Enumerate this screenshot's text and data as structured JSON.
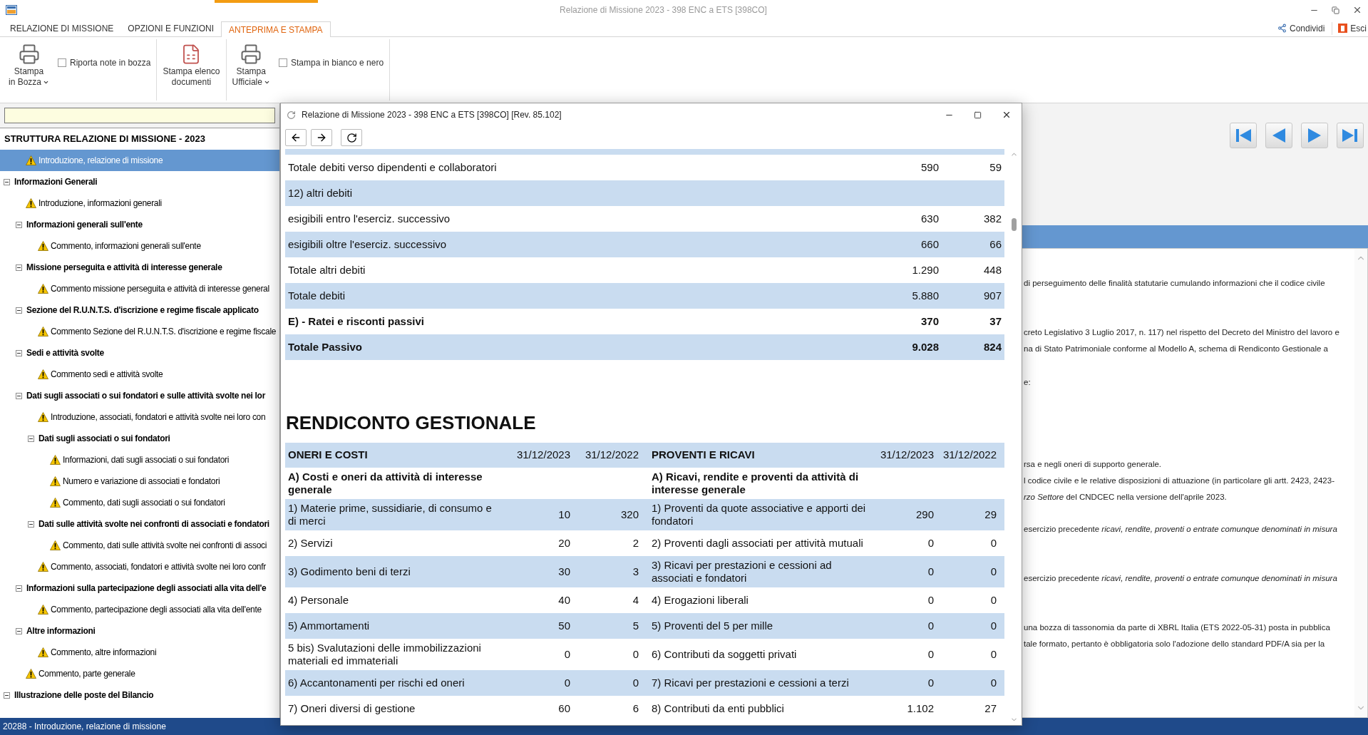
{
  "app": {
    "title": "Relazione di Missione 2023 - 398 ENC a ETS [398CO]"
  },
  "ribbon_tabs": [
    {
      "label": "RELAZIONE DI MISSIONE",
      "selected": false
    },
    {
      "label": "OPZIONI E FUNZIONI",
      "selected": false
    },
    {
      "label": "ANTEPRIMA E STAMPA",
      "selected": true
    }
  ],
  "ribbon_actions": [
    {
      "kind": "share",
      "label": "Condividi"
    },
    {
      "kind": "exit",
      "label": "Esci"
    }
  ],
  "ribbon": {
    "groups": [
      {
        "items": [
          {
            "kind": "print",
            "lines": [
              "Stampa",
              "in Bozza"
            ],
            "dropdown": true
          },
          {
            "kind": "checkbox",
            "label": "Riporta note in bozza",
            "checked": false
          }
        ]
      },
      {
        "items": [
          {
            "kind": "list",
            "lines": [
              "Stampa elenco",
              "documenti"
            ],
            "dropdown": false
          }
        ]
      },
      {
        "items": [
          {
            "kind": "print",
            "lines": [
              "Stampa",
              "Ufficiale"
            ],
            "dropdown": true
          },
          {
            "kind": "checkbox",
            "label": "Stampa in bianco e nero",
            "checked": false
          }
        ]
      }
    ]
  },
  "tree": {
    "title": "STRUTTURA RELAZIONE DI MISSIONE - 2023",
    "items": [
      {
        "kind": "item",
        "label": "Introduzione, relazione di missione",
        "selected": true
      },
      {
        "kind": "folder",
        "label": "Informazioni Generali",
        "selected": false,
        "expanded": true,
        "children": [
          {
            "kind": "item",
            "label": "Introduzione, informazioni generali",
            "selected": false
          },
          {
            "kind": "folder",
            "label": "Informazioni generali sull'ente",
            "selected": false,
            "expanded": true,
            "children": [
              {
                "kind": "item",
                "label": "Commento, informazioni generali sull'ente",
                "selected": false
              }
            ]
          },
          {
            "kind": "folder",
            "label": "Missione perseguita e attività di interesse generale",
            "selected": false,
            "expanded": true,
            "children": [
              {
                "kind": "item",
                "label": "Commento missione perseguita e attività di interesse general",
                "selected": false
              }
            ]
          },
          {
            "kind": "folder",
            "label": "Sezione del R.U.N.T.S. d'iscrizione e regime fiscale applicato",
            "selected": false,
            "expanded": true,
            "children": [
              {
                "kind": "item",
                "label": "Commento Sezione del R.U.N.T.S. d'iscrizione e regime fiscale",
                "selected": false
              }
            ]
          },
          {
            "kind": "folder",
            "label": "Sedi e attività svolte",
            "selected": false,
            "expanded": true,
            "children": [
              {
                "kind": "item",
                "label": "Commento sedi e attività svolte",
                "selected": false
              }
            ]
          },
          {
            "kind": "folder",
            "label": "Dati sugli associati o sui fondatori e sulle attività svolte nei lor",
            "selected": false,
            "expanded": true,
            "children": [
              {
                "kind": "item",
                "label": "Introduzione, associati, fondatori e attività svolte nei loro con",
                "selected": false
              },
              {
                "kind": "folder",
                "label": "Dati sugli associati o sui fondatori",
                "selected": false,
                "expanded": true,
                "children": [
                  {
                    "kind": "item",
                    "label": "Informazioni, dati sugli associati o sui fondatori",
                    "selected": false
                  },
                  {
                    "kind": "item",
                    "label": "Numero e variazione di associati e fondatori",
                    "selected": false
                  },
                  {
                    "kind": "item",
                    "label": "Commento, dati sugli associati o sui fondatori",
                    "selected": false
                  }
                ]
              },
              {
                "kind": "folder",
                "label": "Dati sulle attività svolte nei confronti di associati e fondatori",
                "selected": false,
                "expanded": true,
                "children": [
                  {
                    "kind": "item",
                    "label": "Commento, dati sulle attività svolte nei confronti di associ",
                    "selected": false
                  }
                ]
              },
              {
                "kind": "item",
                "label": "Commento, associati, fondatori e attività svolte nei loro confr",
                "selected": false
              }
            ]
          },
          {
            "kind": "folder",
            "label": "Informazioni sulla partecipazione degli associati alla vita dell'e",
            "selected": false,
            "expanded": true,
            "children": [
              {
                "kind": "item",
                "label": "Commento, partecipazione degli associati alla vita dell'ente",
                "selected": false
              }
            ]
          },
          {
            "kind": "folder",
            "label": "Altre informazioni",
            "selected": false,
            "expanded": true,
            "children": [
              {
                "kind": "item",
                "label": "Commento,  altre  informazioni",
                "selected": false
              }
            ]
          },
          {
            "kind": "item",
            "label": "Commento, parte generale",
            "selected": false
          }
        ]
      },
      {
        "kind": "folder",
        "label": "Illustrazione delle poste del Bilancio",
        "selected": false,
        "expanded": true
      }
    ]
  },
  "right_pane": {
    "paragraphs": [
      [
        "di perseguimento delle finalità statutarie cumulando informazioni che il codice civile"
      ],
      [
        "creto Legislativo 3 Luglio 2017, n. 117) nel rispetto del Decreto del Ministro del lavoro e",
        "na di Stato Patrimoniale conforme al Modello A, schema di Rendiconto Gestionale a"
      ],
      [
        "e:"
      ],
      [
        "rsa e negli oneri di supporto generale.",
        "l codice civile e le relative disposizioni di attuazione (in particolare gli artt. 2423, 2423-",
        "*rzo Settore* del CNDCEC nella versione dell'aprile 2023."
      ],
      [
        "esercizio precedente *ricavi, rendite, proventi o entrate comunque denominati in misura*"
      ],
      [
        "esercizio precedente *ricavi, rendite, proventi o entrate comunque denominati in misura*"
      ],
      [
        "una bozza di tassonomia da parte di XBRL Italia (ETS 2022-05-31) posta in pubblica",
        "tale formato, pertanto è obbligatoria solo l'adozione dello standard PDF/A sia per la"
      ]
    ]
  },
  "preview_window": {
    "title": "Relazione di Missione 2023 - 398 ENC a ETS [398CO] [Rev. 85.102]",
    "balance_rows": [
      {
        "label": "Totale debiti verso dipendenti e collaboratori",
        "value_2023": "590",
        "value_2022": "59",
        "bold": false
      },
      {
        "label": "12) altri debiti",
        "bold": false
      },
      {
        "label": "esigibili entro l'eserciz. successivo",
        "value_2023": "630",
        "value_2022": "382",
        "bold": false
      },
      {
        "label": "esigibili oltre l'eserciz. successivo",
        "value_2023": "660",
        "value_2022": "66",
        "bold": false
      },
      {
        "label": "Totale altri debiti",
        "value_2023": "1.290",
        "value_2022": "448",
        "bold": false
      },
      {
        "label": "Totale debiti",
        "value_2023": "5.880",
        "value_2022": "907",
        "bold": false
      },
      {
        "label": "E) - Ratei e risconti passivi",
        "value_2023": "370",
        "value_2022": "37",
        "bold": true
      },
      {
        "label": "Totale Passivo",
        "value_2023": "9.028",
        "value_2022": "824",
        "bold": true
      }
    ],
    "section_title": "RENDICONTO GESTIONALE",
    "columns": [
      "ONERI E COSTI",
      "31/12/2023",
      "31/12/2022",
      "PROVENTI E RICAVI",
      "31/12/2023",
      "31/12/2022"
    ],
    "rows": [
      {
        "kind": "group",
        "cost": "A) Costi e oneri da attività di interesse generale",
        "revenue": "A) Ricavi, rendite e proventi da attività di interesse generale"
      },
      {
        "kind": "item",
        "cost": "1) Materie prime, sussidiarie, di consumo e di merci",
        "cost_2023": "10",
        "cost_2022": "320",
        "revenue": "1) Proventi da quote associative e apporti dei fondatori",
        "revenue_2023": "290",
        "revenue_2022": "29"
      },
      {
        "kind": "item",
        "cost": "2) Servizi",
        "cost_2023": "20",
        "cost_2022": "2",
        "revenue": "2) Proventi dagli associati per attività mutuali",
        "revenue_2023": "0",
        "revenue_2022": "0"
      },
      {
        "kind": "item",
        "cost": "3) Godimento beni di terzi",
        "cost_2023": "30",
        "cost_2022": "3",
        "revenue": "3) Ricavi per prestazioni e cessioni ad associati e fondatori",
        "revenue_2023": "0",
        "revenue_2022": "0"
      },
      {
        "kind": "item",
        "cost": "4) Personale",
        "cost_2023": "40",
        "cost_2022": "4",
        "revenue": "4) Erogazioni liberali",
        "revenue_2023": "0",
        "revenue_2022": "0"
      },
      {
        "kind": "item",
        "cost": "5) Ammortamenti",
        "cost_2023": "50",
        "cost_2022": "5",
        "revenue": "5) Proventi del 5 per mille",
        "revenue_2023": "0",
        "revenue_2022": "0"
      },
      {
        "kind": "item",
        "cost": "5 bis) Svalutazioni delle immobilizzazioni materiali ed immateriali",
        "cost_2023": "0",
        "cost_2022": "0",
        "revenue": "6) Contributi da soggetti privati",
        "revenue_2023": "0",
        "revenue_2022": "0"
      },
      {
        "kind": "item",
        "cost": "6) Accantonamenti per rischi ed oneri",
        "cost_2023": "0",
        "cost_2022": "0",
        "revenue": "7) Ricavi per prestazioni e cessioni a terzi",
        "revenue_2023": "0",
        "revenue_2022": "0"
      },
      {
        "kind": "item",
        "cost": "7) Oneri diversi di gestione",
        "cost_2023": "60",
        "cost_2022": "6",
        "revenue": "8) Contributi da enti pubblici",
        "revenue_2023": "1.102",
        "revenue_2022": "27"
      }
    ]
  },
  "status_bar": {
    "text": "20288 - Introduzione, relazione di missione"
  }
}
